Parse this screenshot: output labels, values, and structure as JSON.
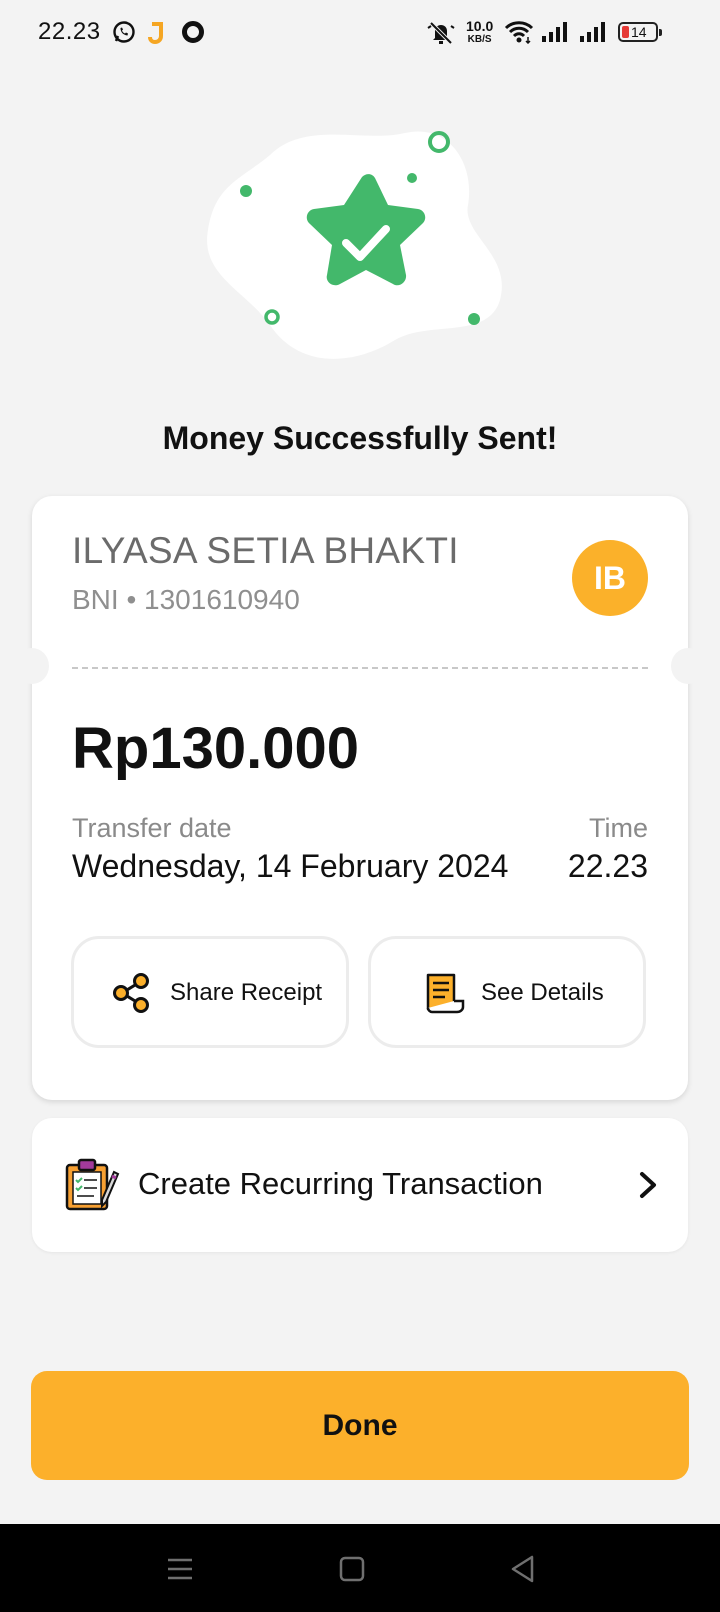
{
  "status_bar": {
    "time": "22.23",
    "net_speed": "10.0",
    "net_unit": "KB/S",
    "battery": "14",
    "icons": [
      "whatsapp-icon",
      "app-notification-icon",
      "circle-app-icon",
      "mute-icon",
      "wifi-icon",
      "signal-icon",
      "signal-icon",
      "battery-icon"
    ]
  },
  "success": {
    "title": "Money Successfully Sent!",
    "icon": "star-check-icon",
    "accent_color": "#43b86b"
  },
  "recipient": {
    "name": "ILYASA SETIA BHAKTI",
    "bank_account": "BNI • 1301610940",
    "initials": "IB",
    "avatar_color": "#fbb12a"
  },
  "transfer": {
    "amount": "Rp130.000",
    "date_label": "Transfer date",
    "date_value": "Wednesday, 14 February 2024",
    "time_label": "Time",
    "time_value": "22.23"
  },
  "actions": {
    "share_label": "Share Receipt",
    "share_icon": "share-icon",
    "details_label": "See Details",
    "details_icon": "receipt-icon"
  },
  "recurring": {
    "label": "Create Recurring Transaction",
    "icon": "clipboard-pencil-icon",
    "chevron": "chevron-right-icon"
  },
  "done_label": "Done",
  "primary_color": "#fcb02b",
  "nav": [
    "menu-icon",
    "home-icon",
    "back-icon"
  ]
}
